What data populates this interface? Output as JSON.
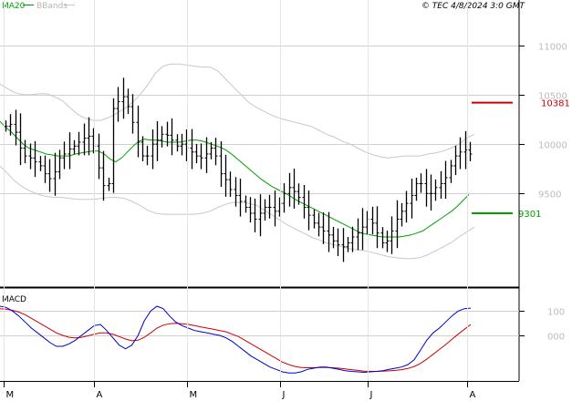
{
  "header": {
    "legend_ma20": "MA20",
    "legend_bbands": "BBands",
    "copyright": "© TEC 4/8/2024 3:0 GMT"
  },
  "colors": {
    "bars": "#000000",
    "ma20": "#00a000",
    "bbands": "#c8c8c8",
    "macd": "#0000cc",
    "signal": "#cc0000",
    "resistance": "#cc0000",
    "support": "#00a000",
    "grid": "#d0d0d0"
  },
  "chart_data": [
    {
      "type": "ohlc",
      "panel": "price",
      "x_tick_labels": [
        "M",
        "A",
        "M",
        "J",
        "J",
        "A"
      ],
      "y_ticks": [
        9500,
        10000,
        10500,
        11000
      ],
      "y_tick_labels": [
        "9500",
        "10000",
        "10500",
        "11000"
      ],
      "ylim": [
        8580,
        11330
      ],
      "overlays": [
        "MA20",
        "BBands"
      ],
      "levels": [
        {
          "name": "resistance",
          "label": "10381",
          "value": 10420
        },
        {
          "name": "support",
          "label": "9301",
          "value": 9300
        }
      ],
      "close": [
        10180,
        10200,
        10120,
        9960,
        9880,
        9860,
        9820,
        9780,
        9700,
        9650,
        9720,
        9860,
        9900,
        9950,
        9980,
        10020,
        10060,
        10080,
        9980,
        9760,
        9580,
        9600,
        10360,
        10430,
        10480,
        10380,
        10220,
        10020,
        9880,
        9880,
        10000,
        10040,
        10100,
        10090,
        10040,
        9980,
        10000,
        9960,
        9920,
        9880,
        9860,
        9900,
        9960,
        9880,
        9700,
        9640,
        9540,
        9480,
        9420,
        9360,
        9300,
        9240,
        9300,
        9360,
        9360,
        9320,
        9400,
        9500,
        9560,
        9520,
        9460,
        9360,
        9280,
        9200,
        9160,
        9120,
        9080,
        9020,
        8980,
        8960,
        9000,
        9060,
        9100,
        9160,
        9240,
        9200,
        9100,
        9000,
        9020,
        9120,
        9240,
        9320,
        9400,
        9480,
        9600,
        9600,
        9500,
        9500,
        9560,
        9600,
        9660,
        9780,
        9880,
        9920,
        9940,
        9900
      ],
      "ma20": [
        10230,
        10170,
        10120,
        10060,
        10000,
        9960,
        9940,
        9920,
        9900,
        9890,
        9880,
        9880,
        9880,
        9900,
        9910,
        9920,
        9930,
        9930,
        9900,
        9850,
        9820,
        9860,
        9920,
        9980,
        10030,
        10050,
        10040,
        10040,
        10030,
        10020,
        10020,
        10020,
        10030,
        10040,
        10040,
        10030,
        10010,
        9990,
        9970,
        9940,
        9900,
        9850,
        9800,
        9750,
        9700,
        9650,
        9610,
        9570,
        9540,
        9510,
        9480,
        9440,
        9410,
        9380,
        9350,
        9320,
        9290,
        9260,
        9230,
        9200,
        9170,
        9140,
        9110,
        9090,
        9080,
        9070,
        9060,
        9060,
        9060,
        9060,
        9070,
        9080,
        9100,
        9120,
        9160,
        9200,
        9240,
        9280,
        9320,
        9370,
        9430,
        9490
      ],
      "bb_upper": [
        10610,
        10560,
        10520,
        10500,
        10500,
        10510,
        10510,
        10480,
        10440,
        10370,
        10300,
        10260,
        10240,
        10240,
        10270,
        10310,
        10360,
        10420,
        10500,
        10600,
        10720,
        10790,
        10810,
        10810,
        10800,
        10790,
        10780,
        10780,
        10740,
        10660,
        10580,
        10500,
        10420,
        10370,
        10330,
        10290,
        10260,
        10240,
        10220,
        10200,
        10180,
        10140,
        10100,
        10070,
        10030,
        10000,
        9960,
        9920,
        9890,
        9870,
        9860,
        9870,
        9880,
        9880,
        9880,
        9900,
        9910,
        9930,
        9960,
        10000,
        10060,
        10100
      ],
      "bb_lower": [
        9780,
        9700,
        9620,
        9560,
        9520,
        9490,
        9470,
        9460,
        9460,
        9450,
        9440,
        9440,
        9440,
        9450,
        9460,
        9460,
        9450,
        9420,
        9380,
        9330,
        9300,
        9290,
        9290,
        9290,
        9290,
        9290,
        9300,
        9320,
        9360,
        9390,
        9410,
        9410,
        9400,
        9380,
        9330,
        9280,
        9230,
        9180,
        9140,
        9100,
        9060,
        9030,
        9000,
        8980,
        8960,
        8940,
        8930,
        8920,
        8900,
        8880,
        8860,
        8850,
        8840,
        8840,
        8850,
        8880,
        8920,
        8960,
        9000,
        9060,
        9110,
        9160
      ]
    },
    {
      "type": "line",
      "panel": "macd",
      "title": "MACD",
      "y_ticks": [
        0,
        100
      ],
      "y_tick_labels": [
        "000",
        "100"
      ],
      "ylim": [
        -180,
        180
      ],
      "series": [
        {
          "key": "macd",
          "values": [
            120,
            115,
            100,
            80,
            55,
            30,
            10,
            -10,
            -30,
            -45,
            -45,
            -35,
            -20,
            0,
            20,
            40,
            45,
            20,
            -10,
            -40,
            -55,
            -40,
            0,
            60,
            100,
            120,
            110,
            80,
            55,
            40,
            30,
            20,
            15,
            10,
            5,
            0,
            -10,
            -25,
            -45,
            -65,
            -85,
            -100,
            -115,
            -130,
            -140,
            -150,
            -155,
            -155,
            -150,
            -140,
            -135,
            -130,
            -130,
            -135,
            -140,
            -145,
            -148,
            -150,
            -152,
            -150,
            -148,
            -145,
            -140,
            -135,
            -130,
            -120,
            -100,
            -60,
            -20,
            10,
            30,
            55,
            80,
            100,
            110,
            112
          ]
        },
        {
          "key": "signal",
          "values": [
            110,
            108,
            103,
            96,
            85,
            70,
            55,
            40,
            25,
            10,
            0,
            -8,
            -10,
            -8,
            -2,
            5,
            10,
            10,
            5,
            -5,
            -15,
            -22,
            -20,
            -8,
            10,
            30,
            42,
            48,
            50,
            48,
            45,
            40,
            35,
            30,
            25,
            20,
            15,
            5,
            -5,
            -20,
            -35,
            -50,
            -65,
            -80,
            -95,
            -110,
            -120,
            -128,
            -132,
            -133,
            -133,
            -132,
            -132,
            -133,
            -135,
            -138,
            -141,
            -144,
            -147,
            -148,
            -148,
            -147,
            -146,
            -144,
            -141,
            -136,
            -128,
            -115,
            -98,
            -78,
            -58,
            -38,
            -16,
            5,
            25,
            45
          ]
        }
      ]
    }
  ]
}
